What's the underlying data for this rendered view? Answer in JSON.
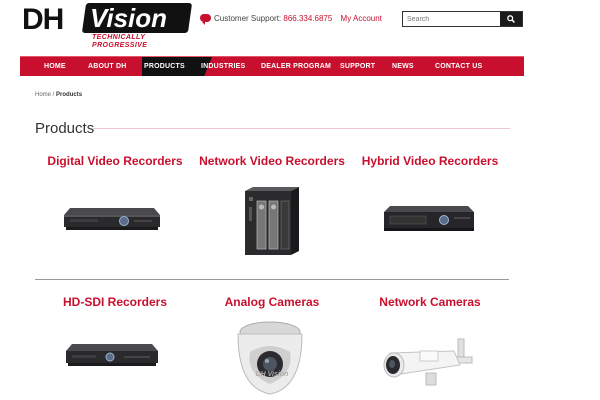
{
  "brand": {
    "logo_main": "DH",
    "logo_box": "Vision",
    "tagline": "TECHNICALLY PROGRESSIVE",
    "accent_color": "#c8102e"
  },
  "header": {
    "support_label": "Customer Support:",
    "support_phone": "866.334.6875",
    "account_link": "My Account",
    "search_placeholder": "Search",
    "search_icon": "search-icon",
    "chat_icon": "chat-icon"
  },
  "nav": {
    "items": [
      {
        "label": "HOME"
      },
      {
        "label": "ABOUT DH"
      },
      {
        "label": "PRODUCTS",
        "active": true
      },
      {
        "label": "INDUSTRIES"
      },
      {
        "label": "DEALER PROGRAM"
      },
      {
        "label": "SUPPORT"
      },
      {
        "label": "NEWS"
      },
      {
        "label": "CONTACT US"
      }
    ]
  },
  "breadcrumb": {
    "home": "Home",
    "separator": " / ",
    "current": "Products"
  },
  "page": {
    "title": "Products"
  },
  "categories": [
    {
      "name": "Digital Video Recorders",
      "image": "dvr-device"
    },
    {
      "name": "Network Video Recorders",
      "image": "nvr-device"
    },
    {
      "name": "Hybrid Video Recorders",
      "image": "hvr-device"
    },
    {
      "name": "HD-SDI Recorders",
      "image": "hdsdi-recorder-device"
    },
    {
      "name": "Analog Cameras",
      "image": "dome-camera"
    },
    {
      "name": "Network Cameras",
      "image": "bullet-camera"
    }
  ],
  "camera_label": "DH Vision"
}
